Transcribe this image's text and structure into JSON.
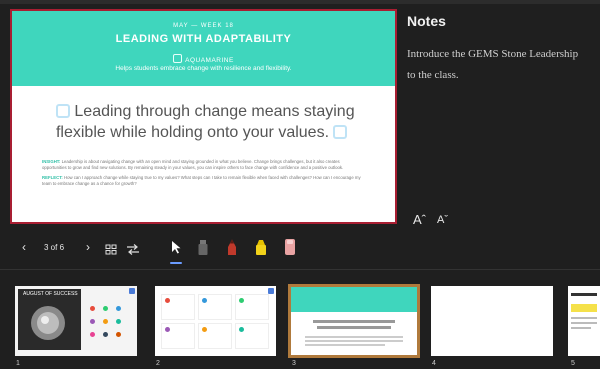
{
  "slide": {
    "week": "MAY — WEEK 18",
    "title": "LEADING WITH ADAPTABILITY",
    "stone": "AQUAMARINE",
    "subtitle": "Helps students embrace change with resilience and flexibility.",
    "quote_line1": "Leading through change means staying",
    "quote_line2": "flexible while holding onto your values.",
    "para1_key": "INSIGHT:",
    "para1": "Leadership is about navigating change with an open mind and staying grounded in what you believe. Change brings challenges, but it also creates opportunities to grow and find new solutions. By remaining steady in your values, you can inspire others to face change with confidence and a positive outlook.",
    "para2_key": "REFLECT:",
    "para2": "How can I approach change while staying true to my values? What steps can I take to remain flexible when faced with challenges? How can I encourage my team to embrace change as a chance for growth?"
  },
  "notes": {
    "title": "Notes",
    "line1": "Introduce the GEMS Stone Leadership",
    "line2": "to the class."
  },
  "font_controls": {
    "increase": "Aˆ",
    "decrease": "Aˇ"
  },
  "toolbar": {
    "page": "3 of 6"
  },
  "thumb1": {
    "title": "AUGUST OF SUCCESS"
  },
  "thumbnails": [
    "1",
    "2",
    "3",
    "4",
    "5"
  ],
  "colors": {
    "accent": "#3fd6bd",
    "current_border": "#a81e32",
    "selected_thumb": "#b07a3c"
  }
}
